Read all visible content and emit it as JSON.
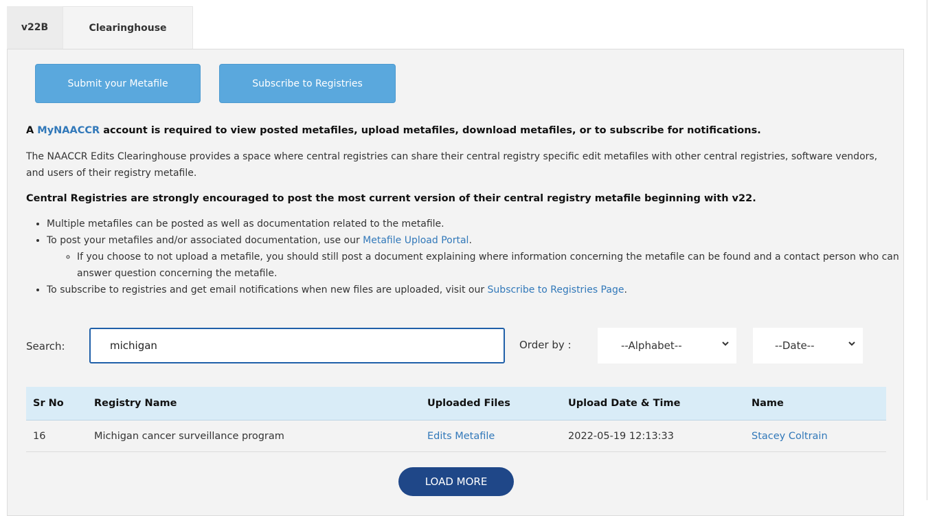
{
  "tabs": [
    {
      "label": "v22B"
    },
    {
      "label": "Clearinghouse"
    }
  ],
  "buttons": {
    "submit": "Submit your Metafile",
    "subscribe": "Subscribe to Registries"
  },
  "notice": {
    "prefix": "A ",
    "link": "MyNAACCR",
    "suffix": " account is required to view posted metafiles, upload metafiles, download metafiles, or to subscribe for notifications."
  },
  "intro": "The NAACCR  Edits Clearinghouse provides a space where central registries can share their central registry specific edit metafiles with other central registries, software vendors, and users of their registry metafile.",
  "encourage": "Central Registries are strongly encouraged to post the most current version of their central registry metafile beginning with v22.",
  "bullets": {
    "b1": "Multiple metafiles can be posted as well as documentation related to the metafile.",
    "b2_text": "To post your metafiles and/or associated documentation, use our ",
    "b2_link": "Metafile Upload Portal",
    "b2_end": ".",
    "b2_sub": "If you choose to not upload a metafile, you should still post a document explaining where information concerning the metafile can be found and a contact person who can answer question concerning the metafile.",
    "b3_text": "To subscribe to registries and get email notifications when new files are uploaded, visit our ",
    "b3_link": "Subscribe to Registries Page",
    "b3_end": "."
  },
  "search": {
    "label": "Search:",
    "value": "michigan"
  },
  "order": {
    "label": "Order by :",
    "alphabet": "--Alphabet--",
    "date": "--Date--"
  },
  "table": {
    "headers": [
      "Sr No",
      "Registry Name",
      "Uploaded Files",
      "Upload Date & Time",
      "Name"
    ],
    "rows": [
      {
        "sr": "16",
        "registry": "Michigan cancer surveillance program",
        "file": "Edits Metafile",
        "date": "2022-05-19 12:13:33",
        "name": "Stacey Coltrain"
      }
    ]
  },
  "load_more": "LOAD MORE",
  "colors": {
    "button_blue": "#5aa8dd",
    "link_blue": "#3178b9",
    "load_more_navy": "#1f4788",
    "header_bg": "#d9ecf7"
  }
}
